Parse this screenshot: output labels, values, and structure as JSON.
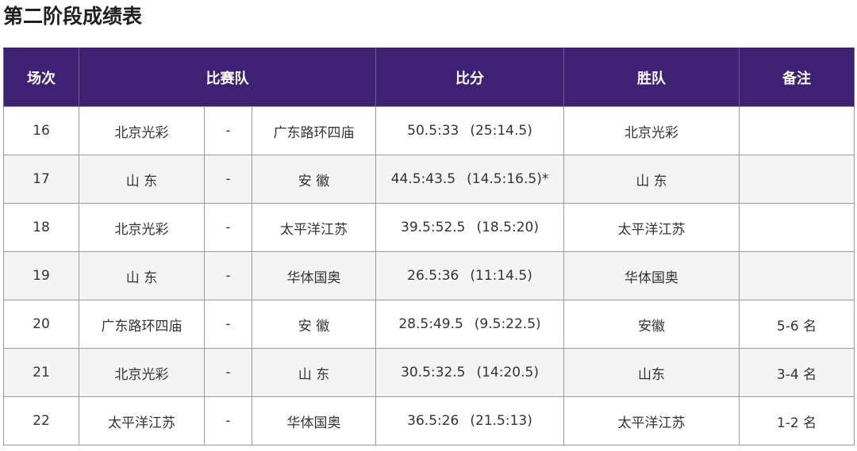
{
  "title": "第二阶段成绩表",
  "table": {
    "headers": {
      "round": "场次",
      "teams": "比赛队",
      "score": "比分",
      "winner": "胜队",
      "note": "备注"
    },
    "rows": [
      {
        "round": "16",
        "team_a": "北京光彩",
        "vs": "-",
        "team_b": "广东路环四庙",
        "points": "50.5:33",
        "halves": "(25:14.5)",
        "winner": "北京光彩",
        "note": ""
      },
      {
        "round": "17",
        "team_a": "山  东",
        "vs": "-",
        "team_b": "安  徽",
        "points": "44.5:43.5",
        "halves": "(14.5:16.5)*",
        "winner": "山  东",
        "note": ""
      },
      {
        "round": "18",
        "team_a": "北京光彩",
        "vs": "-",
        "team_b": "太平洋江苏",
        "points": "39.5:52.5",
        "halves": "(18.5:20)",
        "winner": "太平洋江苏",
        "note": ""
      },
      {
        "round": "19",
        "team_a": "山  东",
        "vs": "-",
        "team_b": "华体国奥",
        "points": "26.5:36",
        "halves": "(11:14.5)",
        "winner": "华体国奥",
        "note": ""
      },
      {
        "round": "20",
        "team_a": "广东路环四庙",
        "vs": "-",
        "team_b": "安  徽",
        "points": "28.5:49.5",
        "halves": "(9.5:22.5)",
        "winner": "安徽",
        "note": "5-6 名"
      },
      {
        "round": "21",
        "team_a": "北京光彩",
        "vs": "-",
        "team_b": "山  东",
        "points": "30.5:32.5",
        "halves": "(14:20.5)",
        "winner": "山东",
        "note": "3-4 名"
      },
      {
        "round": "22",
        "team_a": "太平洋江苏",
        "vs": "-",
        "team_b": "华体国奥",
        "points": "36.5:26",
        "halves": "(21.5:13)",
        "winner": "太平洋江苏",
        "note": "1-2 名"
      }
    ]
  },
  "colors": {
    "header_bg": "#3e2172",
    "header_text": "#ffffff",
    "border": "#9a9a9a",
    "stripe": "#f4f4f4"
  }
}
